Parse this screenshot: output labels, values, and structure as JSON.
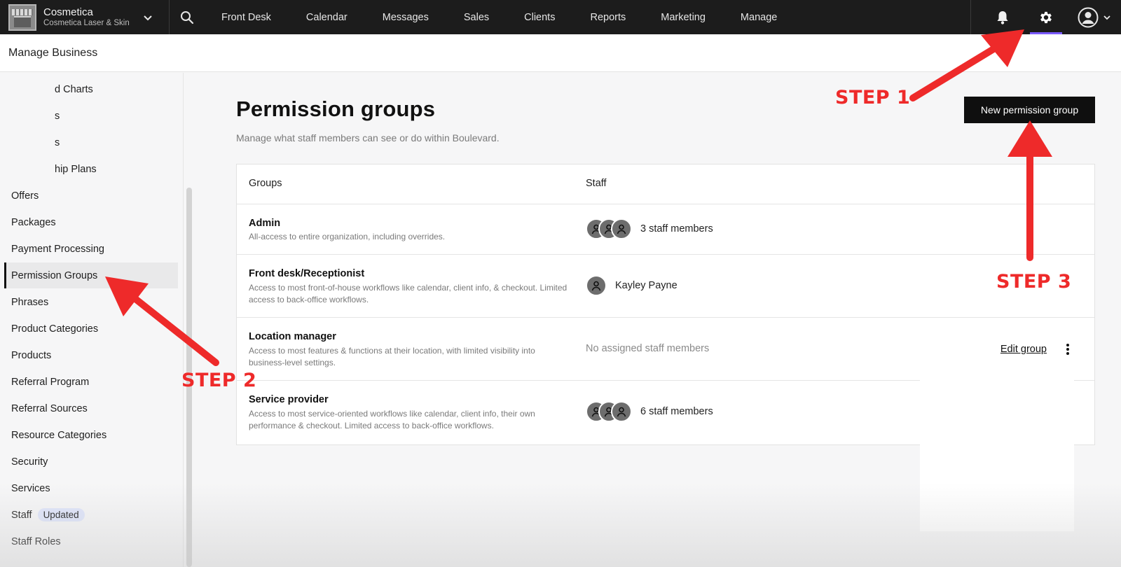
{
  "app": {
    "business_name": "Cosmetica",
    "business_location": "Cosmetica Laser & Skin",
    "nav": [
      "Front Desk",
      "Calendar",
      "Messages",
      "Sales",
      "Clients",
      "Reports",
      "Marketing",
      "Manage"
    ]
  },
  "subheader": {
    "title": "Manage Business"
  },
  "sidebar": {
    "items": [
      {
        "label": "d Charts",
        "cut": true
      },
      {
        "label": "s",
        "cut": true
      },
      {
        "label": "s",
        "cut": true
      },
      {
        "label": "hip Plans",
        "cut": true
      },
      {
        "label": "Offers"
      },
      {
        "label": "Packages"
      },
      {
        "label": "Payment Processing"
      },
      {
        "label": "Permission Groups",
        "active": true
      },
      {
        "label": "Phrases"
      },
      {
        "label": "Product Categories"
      },
      {
        "label": "Products"
      },
      {
        "label": "Referral Program"
      },
      {
        "label": "Referral Sources"
      },
      {
        "label": "Resource Categories"
      },
      {
        "label": "Security"
      },
      {
        "label": "Services"
      },
      {
        "label": "Staff",
        "badge": "Updated"
      },
      {
        "label": "Staff Roles"
      }
    ]
  },
  "main": {
    "title": "Permission groups",
    "subtitle": "Manage what staff members can see or do within Boulevard.",
    "new_button": "New permission group",
    "table": {
      "headers": {
        "groups": "Groups",
        "staff": "Staff"
      },
      "rows": [
        {
          "name": "Admin",
          "desc": "All-access to entire organization, including overrides.",
          "staff": "3 staff members",
          "avatars": 3
        },
        {
          "name": "Front desk/Receptionist",
          "desc": "Access to most front-of-house workflows like calendar, client info, & checkout. Limited access to back-office workflows.",
          "staff": "Kayley Payne",
          "avatars": 1
        },
        {
          "name": "Location manager",
          "desc": "Access to most features & functions at their location, with limited visibility into business-level settings.",
          "staff": "No assigned staff members",
          "avatars": 0,
          "action": "Edit group"
        },
        {
          "name": "Service provider",
          "desc": "Access to most service-oriented workflows like calendar, client info, their own performance & checkout. Limited access to back-office workflows.",
          "staff": "6 staff members",
          "avatars": 3
        }
      ]
    }
  },
  "annotations": {
    "step1": "STEP 1",
    "step2": "STEP 2",
    "step3": "STEP 3"
  },
  "colors": {
    "nav_bg": "#1c1c1c",
    "accent": "#7b5cff",
    "arrow": "#ee2a2a"
  }
}
